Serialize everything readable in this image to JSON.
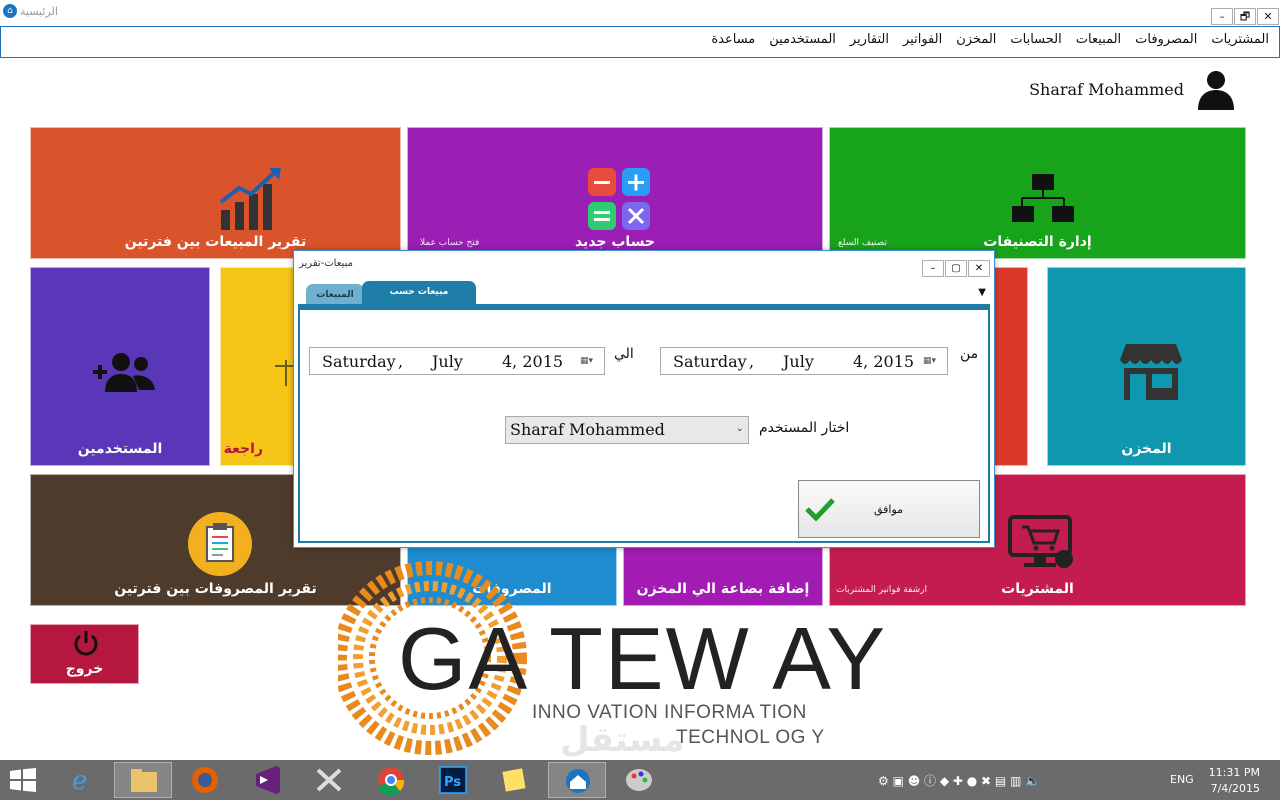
{
  "window": {
    "title": "الرئيسية",
    "minimize": "–",
    "restore": "🗗",
    "close": "✕"
  },
  "menu": [
    "المشتريات",
    "المصروفات",
    "المبيعات",
    "الحسابات",
    "المخزن",
    "الفواتير",
    "التقارير",
    "المستخدمين",
    "مساعدة"
  ],
  "user": {
    "name": "Sharaf Mohammed"
  },
  "tiles": {
    "sales_report": {
      "label": "تقرير المبيعات بين فترتين",
      "color": "#d9542b"
    },
    "new_account": {
      "label": "حساب جديد",
      "sub": "فتح حساب عملا",
      "color": "#9b1eb5"
    },
    "categories": {
      "label": "إدارة التصنيفات",
      "sub": "تصنيف السلع",
      "color": "#17a31a"
    },
    "users": {
      "label": "المستخدمين",
      "color": "#5a37b8"
    },
    "returns": {
      "label": "راجعة",
      "color": "#f5c517"
    },
    "red_tile": {
      "color": "#d9382b"
    },
    "warehouse": {
      "label": "المخزن",
      "color": "#0f97b0"
    },
    "expenses_report": {
      "label": "تقرير المصروفات بين فترتين",
      "color": "#4e3b2c"
    },
    "expenses": {
      "label": "المصروفات",
      "color": "#1e8ccf"
    },
    "add_goods": {
      "label": "إضافة بضاعة الي المخزن",
      "color": "#a21bb3"
    },
    "purchases": {
      "label": "المشتريات",
      "sub": "ارشفة فواتير المشتريات",
      "color": "#c41c4f"
    },
    "exit": {
      "label": "خروج",
      "color": "#b5173f"
    }
  },
  "dialog": {
    "title": "مبيعات-تقرير",
    "tabs": {
      "sales": "المبيعات",
      "by_user": "مبيعات حسب المستخدم"
    },
    "from_label": "من",
    "to_label": "الي",
    "from_date": {
      "weekday": "Saturday",
      "comma": ",",
      "month": "July",
      "day_year": "4, 2015"
    },
    "to_date": {
      "weekday": "Saturday",
      "comma": ",",
      "month": "July",
      "day_year": "4, 2015"
    },
    "select_user_label": "اختار المستخدم",
    "selected_user": "Sharaf Mohammed",
    "ok_label": "موافق"
  },
  "logo": {
    "main": "GA TEW AY",
    "line1": "INNO  VATION INFORMA     TION",
    "line2": "TECHNOL  OG Y"
  },
  "watermark": "مستقل",
  "taskbar": {
    "lang": "ENG",
    "time": "11:31 PM",
    "date": "7/4/2015"
  }
}
